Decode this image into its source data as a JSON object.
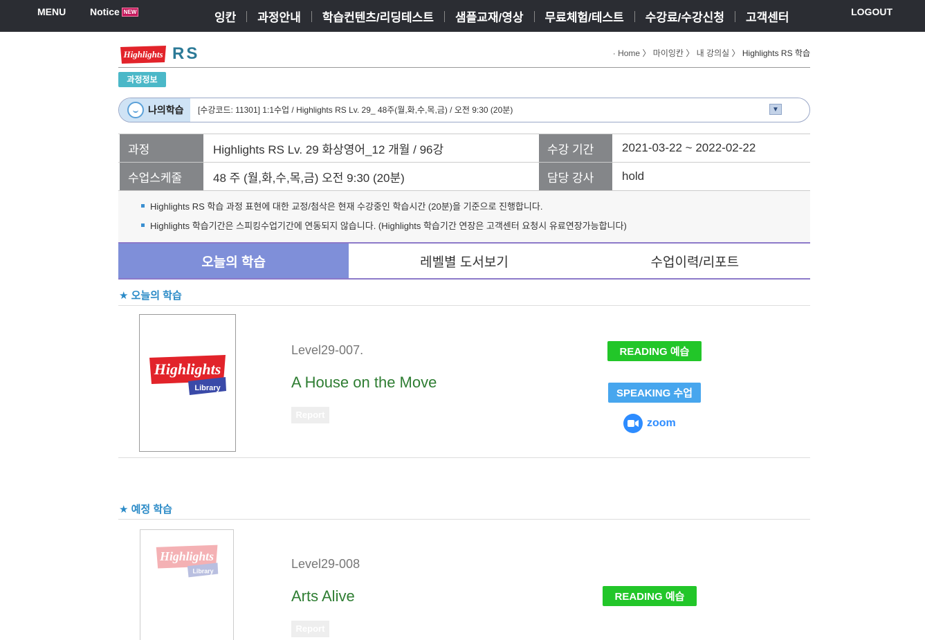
{
  "topbar": {
    "menu": "MENU",
    "notice": "Notice",
    "notice_badge": "NEW",
    "nav": [
      "잉칸",
      "과정안내",
      "학습컨텐츠/리딩테스트",
      "샘플교재/영상",
      "무료체험/테스트",
      "수강료/수강신청",
      "고객센터"
    ],
    "logout": "LOGOUT"
  },
  "header": {
    "logo_text": "Highlights",
    "brand": "RS",
    "breadcrumb": [
      "Home",
      "마이잉칸",
      "내 강의실",
      "Highlights RS 학습"
    ]
  },
  "course_badge": "과정정보",
  "mystudy": {
    "label": "나의학습",
    "selected": "[수강코드: 11301] 1:1수업 / Highlights RS Lv. 29_ 48주(월,화,수,목,금) / 오전 9:30 (20분)"
  },
  "info": {
    "course_label": "과정",
    "course_value": "Highlights RS Lv. 29 화상영어_12 개월 / 96강",
    "period_label": "수강 기간",
    "period_value": "2021-03-22 ~ 2022-02-22",
    "schedule_label": "수업스케줄",
    "schedule_value": "48 주 (월,화,수,목,금) 오전 9:30 (20분)",
    "teacher_label": "담당 강사",
    "teacher_value": "hold"
  },
  "notes": [
    "Highlights RS 학습 과정 표현에 대한 교정/첨삭은 현재 수강중인 학습시간 (20분)을 기준으로 진행합니다.",
    "Highlights 학습기간은 스피킹수업기간에 연동되지 않습니다. (Highlights 학습기간 연장은 고객센터 요청시 유료연장가능합니다)"
  ],
  "tabs": [
    "오늘의 학습",
    "레벨별 도서보기",
    "수업이력/리포트"
  ],
  "today": {
    "section": "★ 오늘의 학습",
    "level": "Level29-007.",
    "title": "A House on the Move",
    "report": "Report",
    "reading_btn": "READING 예습",
    "speaking_btn": "SPEAKING 수업",
    "zoom": "zoom",
    "book_logo": "Highlights",
    "book_sub": "Library"
  },
  "upcoming": {
    "section": "★ 예정 학습",
    "level": "Level29-008",
    "title": "Arts Alive",
    "report": "Report",
    "reading_btn": "READING 예습",
    "book_logo": "Highlights",
    "book_sub": "Library"
  }
}
